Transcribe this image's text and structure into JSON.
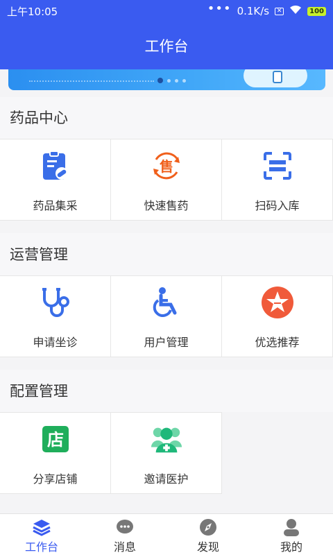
{
  "status_bar": {
    "time": "上午10:05",
    "dots": "•••",
    "network_speed": "0.1K/s",
    "battery": "100"
  },
  "header": {
    "title": "工作台"
  },
  "banner": {
    "dots_count": 7,
    "active_index": 0
  },
  "sections": [
    {
      "title": "药品中心",
      "items": [
        {
          "label": "药品集采",
          "icon": "clipboard-medicine-icon",
          "color": "#3a6ee8"
        },
        {
          "label": "快速售药",
          "icon": "sell-circle-icon",
          "color": "#f0601c"
        },
        {
          "label": "扫码入库",
          "icon": "scan-icon",
          "color": "#3a6ee8"
        }
      ]
    },
    {
      "title": "运营管理",
      "items": [
        {
          "label": "申请坐诊",
          "icon": "stethoscope-icon",
          "color": "#3a6ee8"
        },
        {
          "label": "用户管理",
          "icon": "wheelchair-icon",
          "color": "#3a6ee8"
        },
        {
          "label": "优选推荐",
          "icon": "star-badge-icon",
          "color": "#f05a3a"
        }
      ]
    },
    {
      "title": "配置管理",
      "items": [
        {
          "label": "分享店铺",
          "icon": "store-icon",
          "color": "#1fae5b",
          "glyph": "店"
        },
        {
          "label": "邀请医护",
          "icon": "invite-medical-icon",
          "color": "#1fb87a"
        }
      ]
    }
  ],
  "tab_bar": [
    {
      "label": "工作台",
      "icon": "layers-icon",
      "active": true
    },
    {
      "label": "消息",
      "icon": "chat-bubble-icon",
      "active": false
    },
    {
      "label": "发现",
      "icon": "compass-icon",
      "active": false
    },
    {
      "label": "我的",
      "icon": "user-icon",
      "active": false
    }
  ],
  "colors": {
    "primary": "#3a5bf0",
    "background": "#f4f4f6"
  }
}
